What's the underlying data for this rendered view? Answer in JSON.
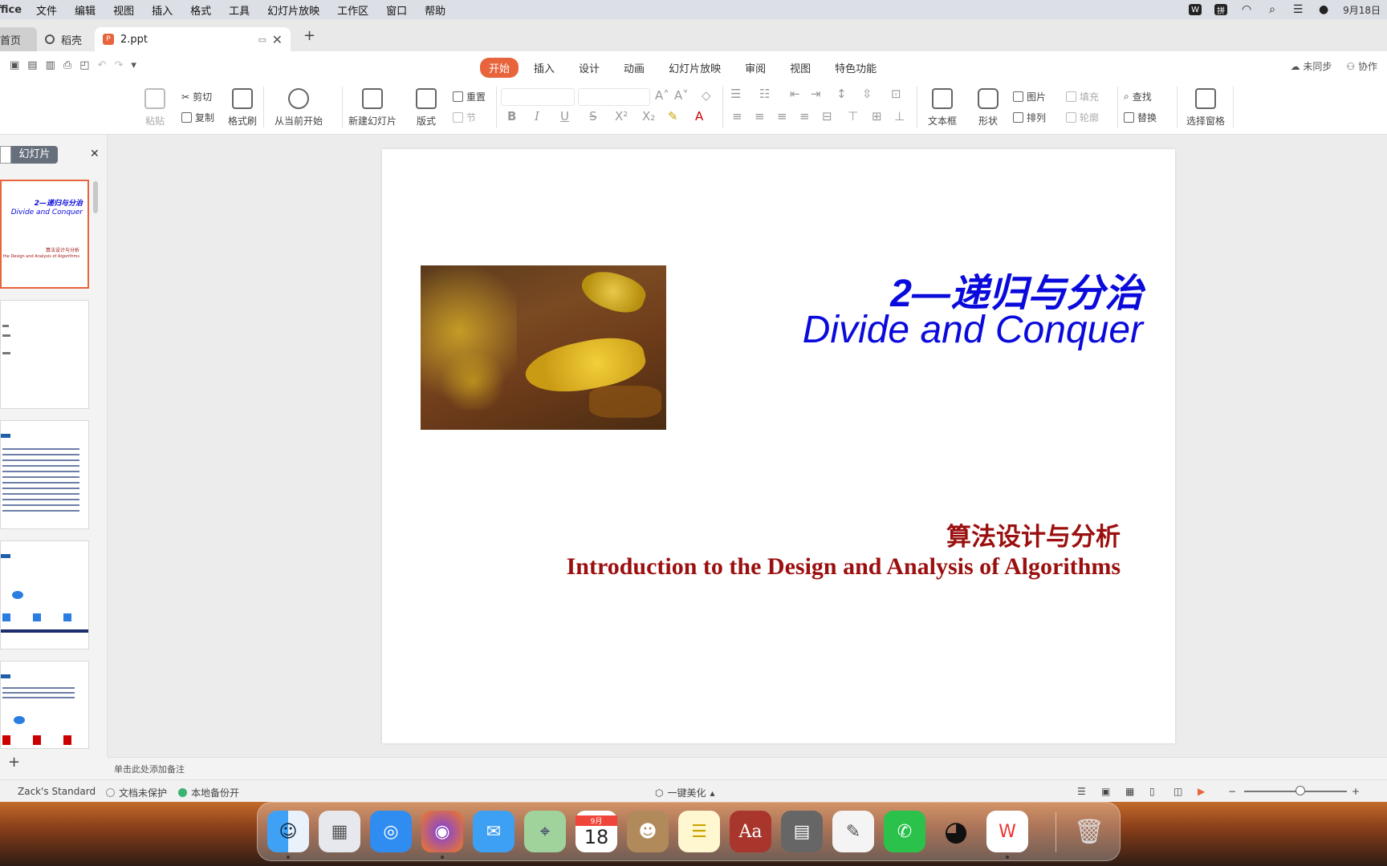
{
  "menubar": {
    "app": "ffice",
    "items": [
      "文件",
      "编辑",
      "视图",
      "插入",
      "格式",
      "工具",
      "幻灯片放映",
      "工作区",
      "窗口",
      "帮助"
    ],
    "date": "9月18日"
  },
  "tabs": {
    "home": "首页",
    "daoke": "稻壳",
    "doc": "2.ppt"
  },
  "ribbon_tabs": [
    "开始",
    "插入",
    "设计",
    "动画",
    "幻灯片放映",
    "审阅",
    "视图",
    "特色功能"
  ],
  "top_right": {
    "sync": "未同步",
    "collab": "协作"
  },
  "ribbon": {
    "paste": "粘贴",
    "cut": "剪切",
    "copy": "复制",
    "format_painter": "格式刷",
    "play_from_current": "从当前开始",
    "new_slide": "新建幻灯片",
    "layout": "版式",
    "reset": "重置",
    "section": "节",
    "textbox": "文本框",
    "shape": "形状",
    "picture": "图片",
    "arrange": "排列",
    "fill": "填充",
    "outline": "轮廓",
    "find": "查找",
    "replace": "替换",
    "select_pane": "选择窗格"
  },
  "left_panel": {
    "tab_label": "幻灯片",
    "thumb1": {
      "line1": "2—递归与分治",
      "line2": "Divide and Conquer",
      "line3": "算法设计与分析",
      "line4": "the Design and Analysis of Algorithms"
    }
  },
  "slide": {
    "title_cn": "2—递归与分治",
    "title_en": "Divide and Conquer",
    "subtitle_cn": "算法设计与分析",
    "subtitle_en": "Introduction to the Design and Analysis of Algorithms"
  },
  "notes_placeholder": "单击此处添加备注",
  "status": {
    "template": "Zack's Standard",
    "protect": "文档未保护",
    "backup": "本地备份开",
    "beautify": "一键美化"
  },
  "dock": {
    "calendar_month": "9月",
    "calendar_day": "18",
    "dict": "Aa"
  },
  "colors": {
    "accent": "#e8643c",
    "title_blue": "#0a0adc",
    "subtitle_red": "#9b0f0f"
  }
}
